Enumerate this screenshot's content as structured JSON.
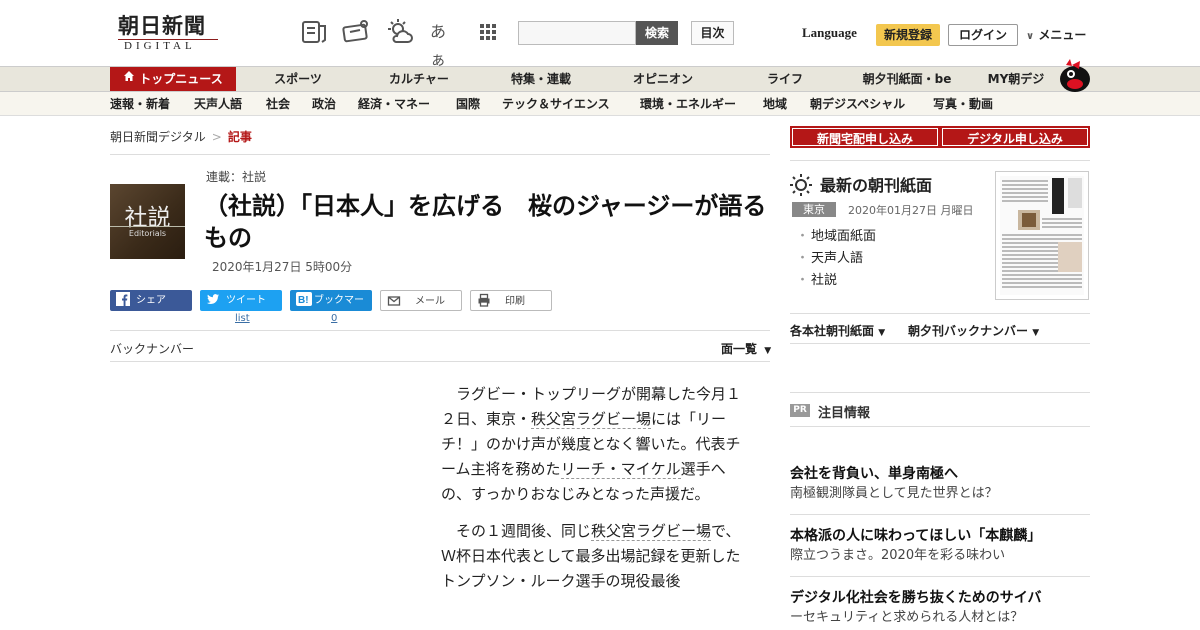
{
  "header": {
    "logo_jp": "朝日新聞",
    "logo_en": "DIGITAL",
    "aa_label": "あぁ",
    "search_placeholder": "",
    "search_label": "検索",
    "contents_label": "目次",
    "language_label": "Language",
    "register_label": "新規登録",
    "login_label": "ログイン",
    "menu_label": "メニュー"
  },
  "nav_primary": [
    {
      "label": "トップニュース",
      "active": true
    },
    {
      "label": "スポーツ"
    },
    {
      "label": "カルチャー"
    },
    {
      "label": "特集・連載"
    },
    {
      "label": "オピニオン"
    },
    {
      "label": "ライフ"
    },
    {
      "label": "朝夕刊紙面・be"
    },
    {
      "label": "MY朝デジ"
    }
  ],
  "nav_secondary": [
    "速報・新着",
    "天声人語",
    "社会",
    "政治",
    "経済・マネー",
    "国際",
    "テック＆サイエンス",
    "環境・エネルギー",
    "地域",
    "朝デジスペシャル",
    "写真・動画"
  ],
  "breadcrumb": {
    "home": "朝日新聞デジタル",
    "sep": ">",
    "current": "記事"
  },
  "article": {
    "thumb_jp": "社説",
    "thumb_en": "Editorials",
    "series": "連載：社説",
    "title": "（社説）「日本人」を広げる　桜のジャージーが語るもの",
    "date": "2020年1月27日 5時00分",
    "share": {
      "facebook": "シェア",
      "twitter": "ツイート",
      "twitter_count": "list",
      "hatena": "ブックマーク",
      "hatena_count": "0",
      "mail": "メール",
      "print": "印刷"
    },
    "back_number": "バックナンバー",
    "page_list": "面一覧"
  },
  "body": {
    "p1_a": "ラグビー・トップリーグが開幕した今月１２日、東京・",
    "p1_link1": "秩父宮ラグビー場",
    "p1_b": "には「リーチ！」のかけ声が幾度となく響いた。代表チーム主将を務めた",
    "p1_link2": "リーチ・マイケル",
    "p1_c": "選手への、すっかりおなじみとなった声援だ。",
    "p2_a": "その１週間後、同じ",
    "p2_link1": "秩父宮ラグビー場",
    "p2_b": "で、Ｗ杯日本代表として最多出場記録を更新したトンプソン・ルーク選手の現役最後"
  },
  "sidebar": {
    "btn_home_delivery": "新聞宅配申し込み",
    "btn_digital": "デジタル申し込み",
    "paper_heading": "最新の朝刊紙面",
    "paper_area": "東京",
    "paper_date": "2020年01月27日 月曜日",
    "paper_links": [
      "地域面紙面",
      "天声人語",
      "社説"
    ],
    "select_regional": "各本社朝刊紙面",
    "select_backnumber": "朝夕刊バックナンバー",
    "pr_badge": "PR",
    "pr_heading": "注目情報",
    "ads": [
      {
        "title": "会社を背負い、単身南極へ",
        "sub": "南極観測隊員として見た世界とは？"
      },
      {
        "title": "本格派の人に味わってほしい「本麒麟」",
        "sub": "際立つうまさ。2020年を彩る味わい"
      },
      {
        "title": "デジタル化社会を勝ち抜くためのサイバ",
        "sub": "ーセキュリティと求められる人材とは？"
      }
    ]
  },
  "colors": {
    "brand_red": "#b41717",
    "register_yellow": "#f3c74f",
    "facebook": "#3b5998",
    "twitter": "#1da1f2",
    "hatena": "#1a8bd6"
  }
}
